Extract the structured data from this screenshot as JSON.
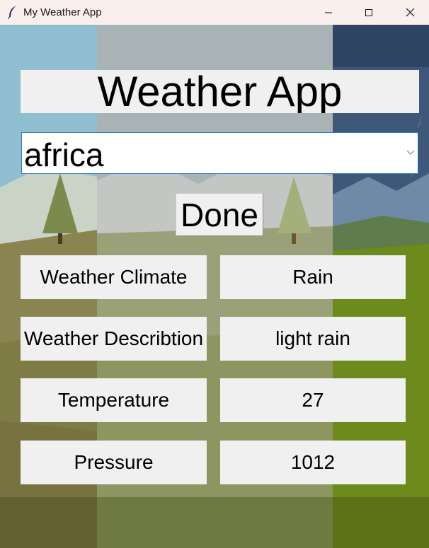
{
  "window": {
    "title": "My Weather App",
    "app_icon": "feather-icon",
    "controls": [
      "minimize-icon",
      "maximize-icon",
      "close-icon"
    ]
  },
  "header": {
    "title": "Weather App"
  },
  "search": {
    "value": "africa",
    "dropdown_icon": "chevron-down-icon"
  },
  "actions": {
    "done_label": "Done"
  },
  "rows": [
    {
      "label": "Weather Climate",
      "value": "Rain"
    },
    {
      "label": "Weather Describtion",
      "value": "light rain"
    },
    {
      "label": "Temperature",
      "value": "27"
    },
    {
      "label": "Pressure",
      "value": "1012"
    }
  ],
  "colors": {
    "titlebar": "#f9efed",
    "panel": "#f0f0f0",
    "combo_focus_border": "#2a79cf",
    "sky_left": "#8fbfcf",
    "sky_right": "#3d5575",
    "grass_right": "#6d8a1c"
  }
}
